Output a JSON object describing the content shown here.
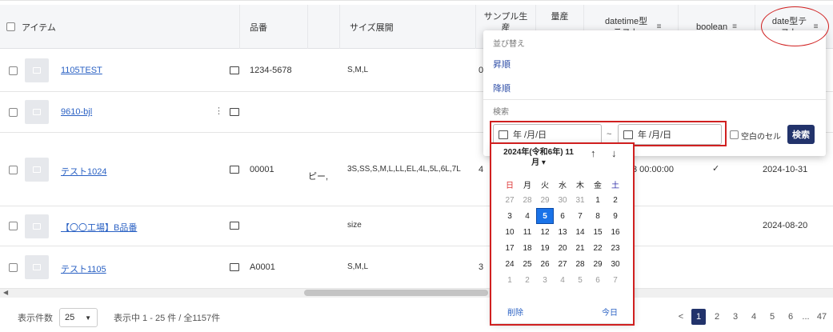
{
  "columns": {
    "item": "アイテム",
    "hinban": "品番",
    "size": "サイズ展開",
    "sample": "サンプル生産",
    "mass": "量産",
    "datetime": "datetime型テスト",
    "boolean": "boolean",
    "date": "date型テスト"
  },
  "rows": [
    {
      "name": "1105TEST",
      "hinban": "1234-5678",
      "size": "S,M,L",
      "sample": "0",
      "dt": "",
      "bool": "",
      "date": ""
    },
    {
      "name": "9610-bjl",
      "hinban": "",
      "size": "",
      "sample": "",
      "dt": "",
      "bool": "",
      "date": ""
    },
    {
      "name": "テスト1024",
      "hinban": "00001",
      "extra": "ピー,",
      "size": "3S,SS,S,M,L,LL,EL,4L,5L,6L,7L",
      "sample": "4",
      "dt": "3 00:00:00",
      "bool": "✓",
      "date": "2024-10-31"
    },
    {
      "name": "【〇〇工場】B品番",
      "hinban": "",
      "size": "size",
      "sample": "",
      "dt": "",
      "bool": "",
      "date": "2024-08-20"
    },
    {
      "name": "テスト1105",
      "hinban": "A0001",
      "size": "S,M,L",
      "sample": "3",
      "dt": "",
      "bool": "",
      "date": ""
    }
  ],
  "footer": {
    "count_label": "表示件数",
    "count_value": "25",
    "range_text": "表示中 1 - 25 件 / 全1157件",
    "pages": [
      "1",
      "2",
      "3",
      "4",
      "5",
      "6",
      "...",
      "47"
    ],
    "prev": "<"
  },
  "popup": {
    "sort_label": "並び替え",
    "asc": "昇順",
    "desc": "降順",
    "search_label": "検索",
    "from_placeholder": "年 /月/日",
    "to_placeholder": "年 /月/日",
    "tilde": "~",
    "blank_cell": "空白のセル",
    "search_btn": "検索"
  },
  "calendar": {
    "title": "2024年(令和6年) 11月 ▾",
    "weekdays": [
      "日",
      "月",
      "火",
      "水",
      "木",
      "金",
      "土"
    ],
    "days": [
      [
        "27",
        "28",
        "29",
        "30",
        "31",
        "1",
        "2"
      ],
      [
        "3",
        "4",
        "5",
        "6",
        "7",
        "8",
        "9"
      ],
      [
        "10",
        "11",
        "12",
        "13",
        "14",
        "15",
        "16"
      ],
      [
        "17",
        "18",
        "19",
        "20",
        "21",
        "22",
        "23"
      ],
      [
        "24",
        "25",
        "26",
        "27",
        "28",
        "29",
        "30"
      ],
      [
        "1",
        "2",
        "3",
        "4",
        "5",
        "6",
        "7"
      ]
    ],
    "selected": "5",
    "clear": "削除",
    "today": "今日"
  },
  "colors": {
    "accent": "#22336b",
    "link": "#2b62c4",
    "highlight": "#d02020"
  }
}
